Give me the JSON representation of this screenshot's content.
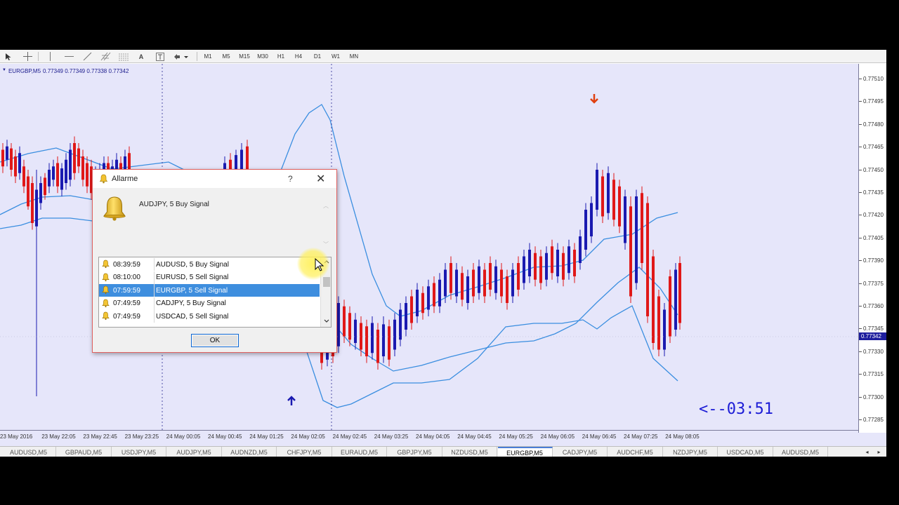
{
  "toolbar": {
    "tools": [
      "cursor-icon",
      "crosshair-icon",
      "vertical-line-icon",
      "horizontal-line-icon",
      "trendline-icon",
      "channel-icon",
      "fibonacci-icon",
      "text-icon",
      "text-label-icon",
      "arrow-shapes-icon"
    ],
    "timeframes": [
      "M1",
      "M5",
      "M15",
      "M30",
      "H1",
      "H4",
      "D1",
      "W1",
      "MN"
    ]
  },
  "chart": {
    "symbol": "EURGBP,M5",
    "ohlc": "0.77349 0.77349 0.77338 0.77342",
    "current_price": "0.77342",
    "countdown": "<--03:51",
    "price_ticks": [
      "0.77510",
      "0.77495",
      "0.77480",
      "0.77465",
      "0.77450",
      "0.77435",
      "0.77420",
      "0.77405",
      "0.77390",
      "0.77375",
      "0.77360",
      "0.77345",
      "0.77330",
      "0.77315",
      "0.77300",
      "0.77285"
    ],
    "time_ticks": [
      "23 May 2016",
      "23 May 22:05",
      "23 May 22:45",
      "23 May 23:25",
      "24 May 00:05",
      "24 May 00:45",
      "24 May 01:25",
      "24 May 02:05",
      "24 May 02:45",
      "24 May 03:25",
      "24 May 04:05",
      "24 May 04:45",
      "24 May 05:25",
      "24 May 06:05",
      "24 May 06:45",
      "24 May 07:25",
      "24 May 08:05"
    ],
    "colors": {
      "bull": "#1a1ab0",
      "bear": "#e01818",
      "bands": "#3a8ee0",
      "background": "#e6e6fa",
      "sell_arrow": "#e04010",
      "buy_arrow": "#1a1ab0"
    }
  },
  "tabs": {
    "items": [
      "AUDUSD,M5",
      "GBPAUD,M5",
      "USDJPY,M5",
      "AUDJPY,M5",
      "AUDNZD,M5",
      "CHFJPY,M5",
      "EURAUD,M5",
      "GBPJPY,M5",
      "NZDUSD,M5",
      "EURGBP,M5",
      "CADJPY,M5",
      "AUDCHF,M5",
      "NZDJPY,M5",
      "USDCAD,M5",
      "AUDUSD,M5"
    ],
    "active": "EURGBP,M5"
  },
  "dialog": {
    "title": "Allarme",
    "help": "?",
    "close": "✕",
    "message": "AUDJPY, 5 Buy Signal",
    "ok_label": "OK",
    "alerts": [
      {
        "time": "08:39:59",
        "message": "AUDUSD, 5 Buy Signal"
      },
      {
        "time": "08:10:00",
        "message": "EURUSD, 5 Sell Signal"
      },
      {
        "time": "07:59:59",
        "message": "EURGBP, 5 Sell Signal"
      },
      {
        "time": "07:49:59",
        "message": "CADJPY, 5 Buy Signal"
      },
      {
        "time": "07:49:59",
        "message": "USDCAD, 5 Sell Signal"
      }
    ],
    "selected_index": 2
  }
}
